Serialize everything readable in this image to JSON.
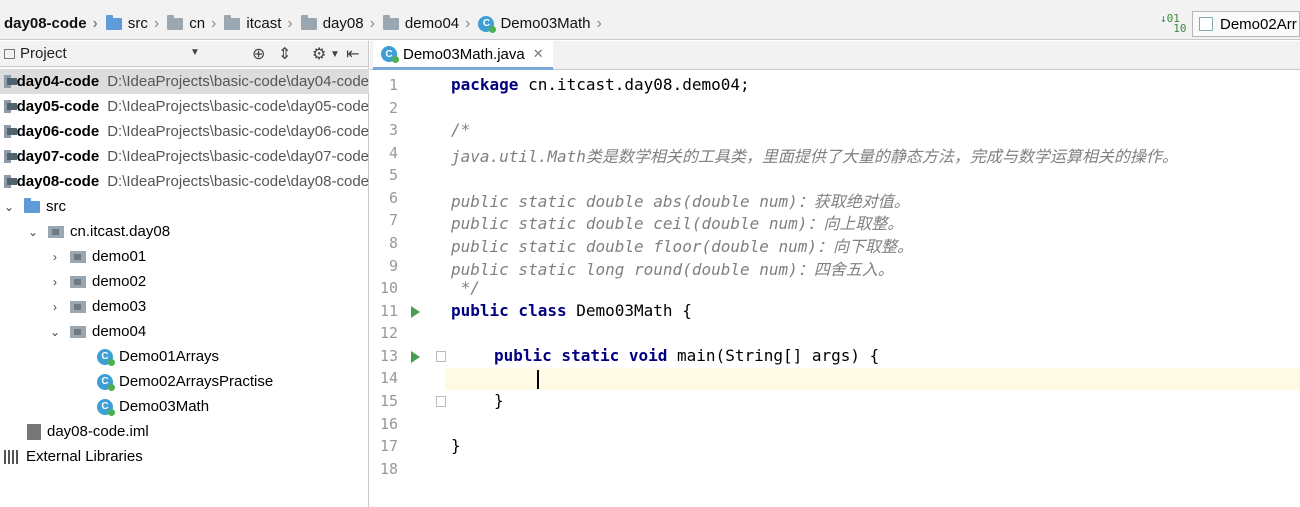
{
  "breadcrumb": [
    {
      "label": "day08-code",
      "icon": "module-icon",
      "bold": true
    },
    {
      "label": "src",
      "icon": "folder-icon"
    },
    {
      "label": "cn",
      "icon": "package-icon"
    },
    {
      "label": "itcast",
      "icon": "package-icon"
    },
    {
      "label": "day08",
      "icon": "package-icon"
    },
    {
      "label": "demo04",
      "icon": "package-icon"
    },
    {
      "label": "Demo03Math",
      "icon": "class-icon"
    }
  ],
  "run_config": {
    "label": "Demo02Arr"
  },
  "project_panel": {
    "title": "Project",
    "projects": [
      {
        "name": "day04-code",
        "path": "D:\\IdeaProjects\\basic-code\\day04-code"
      },
      {
        "name": "day05-code",
        "path": "D:\\IdeaProjects\\basic-code\\day05-code"
      },
      {
        "name": "day06-code",
        "path": "D:\\IdeaProjects\\basic-code\\day06-code"
      },
      {
        "name": "day07-code",
        "path": "D:\\IdeaProjects\\basic-code\\day07-code"
      },
      {
        "name": "day08-code",
        "path": "D:\\IdeaProjects\\basic-code\\day08-code"
      }
    ],
    "src": "src",
    "package": "cn.itcast.day08",
    "packages": [
      "demo01",
      "demo02",
      "demo03",
      "demo04"
    ],
    "classes": [
      "Demo01Arrays",
      "Demo02ArraysPractise",
      "Demo03Math"
    ],
    "iml": "day08-code.iml",
    "libraries": "External Libraries"
  },
  "editor": {
    "tab_label": "Demo03Math.java",
    "line_numbers": [
      "1",
      "2",
      "3",
      "4",
      "5",
      "6",
      "7",
      "8",
      "9",
      "10",
      "11",
      "12",
      "13",
      "14",
      "15",
      "16",
      "17",
      "18"
    ],
    "lines": {
      "l1_kw": "package",
      "l1_rest": " cn.itcast.day08.demo04;",
      "l3": "/*",
      "l4": "java.util.Math类是数学相关的工具类，里面提供了大量的静态方法，完成与数学运算相关的操作。",
      "l6": "public static double abs(double num)：获取绝对值。",
      "l7": "public static double ceil(double num)：向上取整。",
      "l8": "public static double floor(double num)：向下取整。",
      "l9": "public static long round(double num)：四舍五入。",
      "l10": " */",
      "l11_kw": "public class",
      "l11_rest": " Demo03Math {",
      "l13_kw": "public static void",
      "l13_rest": " main(String[] args) {",
      "l15": "}",
      "l17": "}"
    }
  }
}
